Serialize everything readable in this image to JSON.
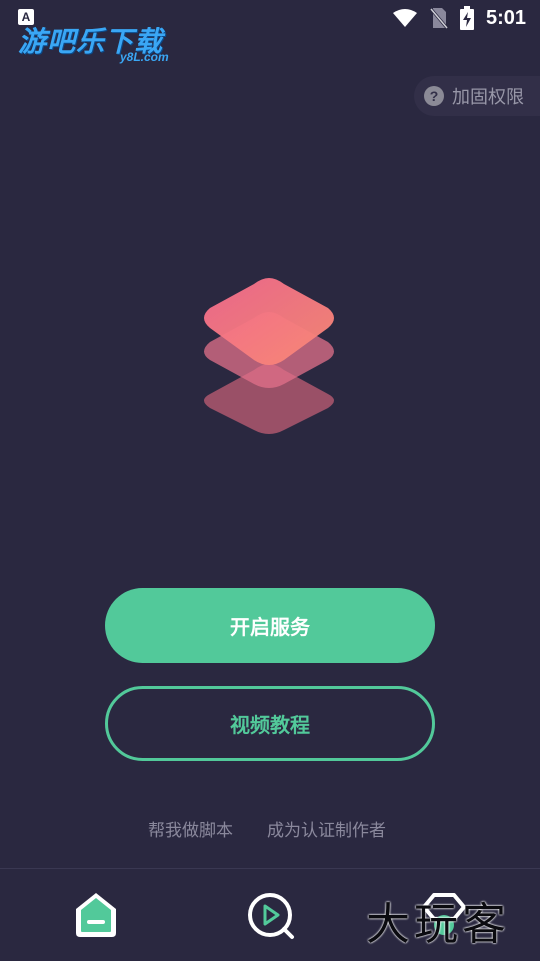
{
  "status_bar": {
    "notification_icon": "A",
    "time": "5:01",
    "icons": [
      "wifi-icon",
      "no-sim-icon",
      "battery-charging-icon"
    ]
  },
  "watermark": {
    "brand_main": "游吧乐下载",
    "brand_sub": "y8L.com",
    "corner_text": "大玩客"
  },
  "permission_button": {
    "icon": "help-icon",
    "label": "加固权限"
  },
  "hero": {
    "icon": "stacked-layers-icon",
    "colors": {
      "top": "#f7707e",
      "mid": "#e2708a",
      "bottom": "#a6546c"
    }
  },
  "actions": {
    "start_label": "开启服务",
    "video_label": "视频教程"
  },
  "links": {
    "script_label": "帮我做脚本",
    "author_label": "成为认证制作者"
  },
  "bottom_nav": {
    "items": [
      {
        "icon": "home-icon",
        "active": true
      },
      {
        "icon": "video-play-icon",
        "active": false
      },
      {
        "icon": "profile-icon",
        "active": false
      }
    ]
  },
  "colors": {
    "background": "#2a2840",
    "accent": "#52c99a",
    "muted_text": "#8a889c"
  }
}
